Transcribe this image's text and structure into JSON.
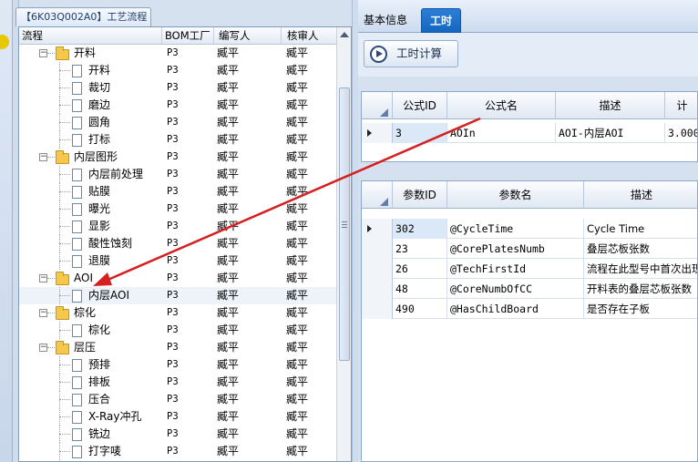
{
  "left_panel": {
    "tab_title": "【6K03Q002A0】工艺流程",
    "columns": [
      "流程",
      "BOM工厂",
      "编写人",
      "核审人"
    ],
    "rows": [
      {
        "level": 0,
        "type": "group",
        "name": "开料",
        "bom": "P3",
        "writer": "臧平",
        "reviewer": "臧平"
      },
      {
        "level": 1,
        "type": "item",
        "name": "开料",
        "bom": "P3",
        "writer": "臧平",
        "reviewer": "臧平"
      },
      {
        "level": 1,
        "type": "item",
        "name": "裁切",
        "bom": "P3",
        "writer": "臧平",
        "reviewer": "臧平"
      },
      {
        "level": 1,
        "type": "item",
        "name": "磨边",
        "bom": "P3",
        "writer": "臧平",
        "reviewer": "臧平"
      },
      {
        "level": 1,
        "type": "item",
        "name": "圆角",
        "bom": "P3",
        "writer": "臧平",
        "reviewer": "臧平"
      },
      {
        "level": 1,
        "type": "item",
        "name": "打标",
        "bom": "P3",
        "writer": "臧平",
        "reviewer": "臧平"
      },
      {
        "level": 0,
        "type": "group",
        "name": "内层图形",
        "bom": "P3",
        "writer": "臧平",
        "reviewer": "臧平"
      },
      {
        "level": 1,
        "type": "item",
        "name": "内层前处理",
        "bom": "P3",
        "writer": "臧平",
        "reviewer": "臧平"
      },
      {
        "level": 1,
        "type": "item",
        "name": "贴膜",
        "bom": "P3",
        "writer": "臧平",
        "reviewer": "臧平"
      },
      {
        "level": 1,
        "type": "item",
        "name": "曝光",
        "bom": "P3",
        "writer": "臧平",
        "reviewer": "臧平"
      },
      {
        "level": 1,
        "type": "item",
        "name": "显影",
        "bom": "P3",
        "writer": "臧平",
        "reviewer": "臧平"
      },
      {
        "level": 1,
        "type": "item",
        "name": "酸性蚀刻",
        "bom": "P3",
        "writer": "臧平",
        "reviewer": "臧平"
      },
      {
        "level": 1,
        "type": "item",
        "name": "退膜",
        "bom": "P3",
        "writer": "臧平",
        "reviewer": "臧平"
      },
      {
        "level": 0,
        "type": "group",
        "name": "AOI",
        "bom": "P3",
        "writer": "臧平",
        "reviewer": "臧平"
      },
      {
        "level": 1,
        "type": "item",
        "name": "内层AOI",
        "bom": "P3",
        "writer": "臧平",
        "reviewer": "臧平",
        "selected": true
      },
      {
        "level": 0,
        "type": "group",
        "name": "棕化",
        "bom": "P3",
        "writer": "臧平",
        "reviewer": "臧平"
      },
      {
        "level": 1,
        "type": "item",
        "name": "棕化",
        "bom": "P3",
        "writer": "臧平",
        "reviewer": "臧平"
      },
      {
        "level": 0,
        "type": "group",
        "name": "层压",
        "bom": "P3",
        "writer": "臧平",
        "reviewer": "臧平"
      },
      {
        "level": 1,
        "type": "item",
        "name": "预排",
        "bom": "P3",
        "writer": "臧平",
        "reviewer": "臧平"
      },
      {
        "level": 1,
        "type": "item",
        "name": "排板",
        "bom": "P3",
        "writer": "臧平",
        "reviewer": "臧平"
      },
      {
        "level": 1,
        "type": "item",
        "name": "压合",
        "bom": "P3",
        "writer": "臧平",
        "reviewer": "臧平"
      },
      {
        "level": 1,
        "type": "item",
        "name": "X-Ray冲孔",
        "bom": "P3",
        "writer": "臧平",
        "reviewer": "臧平"
      },
      {
        "level": 1,
        "type": "item",
        "name": "铣边",
        "bom": "P3",
        "writer": "臧平",
        "reviewer": "臧平"
      },
      {
        "level": 1,
        "type": "item",
        "name": "打字唛",
        "bom": "P3",
        "writer": "臧平",
        "reviewer": "臧平"
      }
    ]
  },
  "right_panel": {
    "tabs": [
      {
        "label": "基本信息",
        "active": false
      },
      {
        "label": "工时",
        "active": true
      }
    ],
    "calc_button": "工时计算",
    "formula_grid": {
      "columns": [
        "公式ID",
        "公式名",
        "描述",
        "计"
      ],
      "rows": [
        {
          "id": "3",
          "name": "AOIn",
          "desc": "AOI-内层AOI",
          "calc": "3.000"
        }
      ]
    },
    "param_grid": {
      "columns": [
        "参数ID",
        "参数名",
        "描述"
      ],
      "rows": [
        {
          "id": "302",
          "name": "@CycleTime",
          "desc": "Cycle Time"
        },
        {
          "id": "23",
          "name": "@CorePlatesNumb",
          "desc": "叠层芯板张数"
        },
        {
          "id": "26",
          "name": "@TechFirstId",
          "desc": "流程在此型号中首次出现"
        },
        {
          "id": "48",
          "name": "@CoreNumbOfCC",
          "desc": "开料表的叠层芯板张数"
        },
        {
          "id": "490",
          "name": "@HasChildBoard",
          "desc": "是否存在子板"
        }
      ]
    }
  },
  "colors": {
    "annotation_arrow": "#d42020",
    "active_tab": "#1a6fc8",
    "selected_cell": "#dbe8f8"
  }
}
